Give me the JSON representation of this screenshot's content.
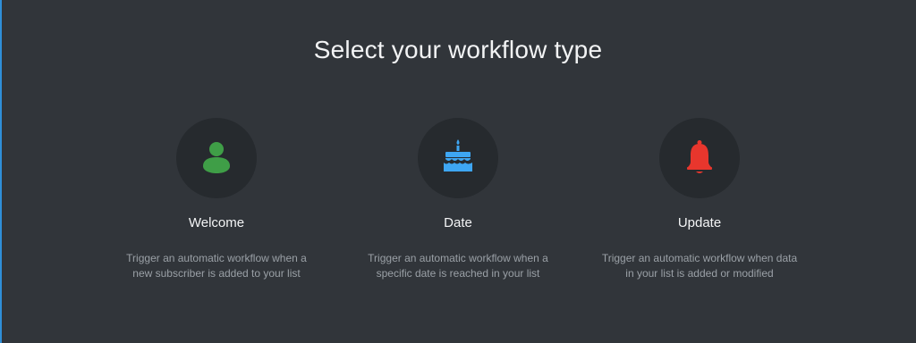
{
  "page": {
    "title": "Select your workflow type"
  },
  "colors": {
    "background": "#31353a",
    "icon_circle": "#262a2e",
    "welcome_icon": "#3f9e47",
    "date_icon": "#3ea6f2",
    "update_icon": "#e8362d"
  },
  "workflows": [
    {
      "label": "Welcome",
      "icon": "user-icon",
      "description": "Trigger an automatic workflow when a new subscriber is added to your list"
    },
    {
      "label": "Date",
      "icon": "birthday-cake-icon",
      "description": "Trigger an automatic workflow when a specific date is reached in your list"
    },
    {
      "label": "Update",
      "icon": "bell-icon",
      "description": "Trigger an automatic workflow when data in your list is added or modified"
    }
  ]
}
